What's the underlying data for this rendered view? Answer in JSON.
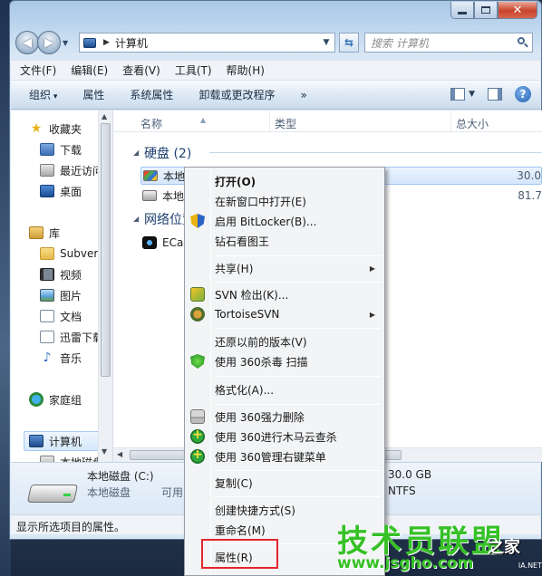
{
  "address": {
    "path": "计算机"
  },
  "search": {
    "placeholder": "搜索 计算机"
  },
  "menubar": {
    "file": "文件(F)",
    "edit": "编辑(E)",
    "view": "查看(V)",
    "tools": "工具(T)",
    "help": "帮助(H)"
  },
  "cmdbar": {
    "organize": "组织",
    "properties": "属性",
    "system_properties": "系统属性",
    "uninstall": "卸载或更改程序",
    "more": "»"
  },
  "navpane": {
    "favorites": "收藏夹",
    "downloads": "下载",
    "recent": "最近访问",
    "desktop": "桌面",
    "libraries": "库",
    "subversion": "Subvers",
    "videos": "视频",
    "pictures": "图片",
    "documents": "文档",
    "thunder": "迅雷下载",
    "music": "音乐",
    "homegroup": "家庭组",
    "computer": "计算机",
    "local_disk": "本地磁盘"
  },
  "columns": {
    "name": "名称",
    "type": "类型",
    "size": "总大小"
  },
  "groups": {
    "hard_disk": "硬盘 (2)",
    "network": "网络位置"
  },
  "rows": [
    {
      "name": "本地磁盘",
      "size": "30.0"
    },
    {
      "name": "本地磁盘",
      "size": "81.7"
    },
    {
      "name": "ECap.c",
      "size": ""
    }
  ],
  "details": {
    "title": "本地磁盘 (C:)",
    "type": "本地磁盘",
    "available": "可用",
    "size": "30.0 GB",
    "fs": "NTFS"
  },
  "status": "显示所选项目的属性。",
  "context_menu": {
    "open": "打开(O)",
    "open_new_window": "在新窗口中打开(E)",
    "bitlocker": "启用 BitLocker(B)...",
    "diamond": "钻石看图王",
    "share": "共享(H)",
    "svn_checkout": "SVN 检出(K)...",
    "tortoise": "TortoiseSVN",
    "restore": "还原以前的版本(V)",
    "scan360": "使用 360杀毒 扫描",
    "format": "格式化(A)...",
    "force_delete": "使用 360强力删除",
    "trojan_scan": "使用 360进行木马云查杀",
    "manage_menu": "使用 360管理右键菜单",
    "copy": "复制(C)",
    "shortcut": "创建快捷方式(S)",
    "rename": "重命名(M)",
    "properties": "属性(R)"
  },
  "watermark": {
    "title": "技术员联盟",
    "home": "之家",
    "url": "www.jsgho.com",
    "domain": "IA.NET"
  }
}
